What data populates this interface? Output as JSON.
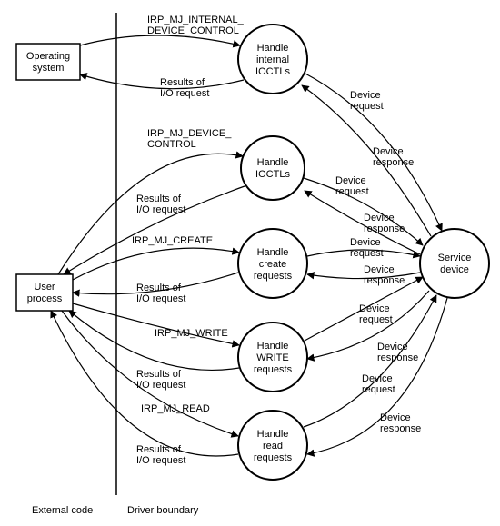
{
  "nodes": {
    "os": {
      "label1": "Operating",
      "label2": "system"
    },
    "user": {
      "label1": "User",
      "label2": "process"
    },
    "h_int": {
      "label1": "Handle",
      "label2": "internal",
      "label3": "IOCTLs"
    },
    "h_ioctl": {
      "label1": "Handle",
      "label2": "IOCTLs",
      "label3": ""
    },
    "h_create": {
      "label1": "Handle",
      "label2": "create",
      "label3": "requests"
    },
    "h_write": {
      "label1": "Handle",
      "label2": "WRITE",
      "label3": "requests"
    },
    "h_read": {
      "label1": "Handle",
      "label2": "read",
      "label3": "requests"
    },
    "svc": {
      "label1": "Service",
      "label2": "device"
    }
  },
  "edge_labels": {
    "irp_int_ioctl": "IRP_MJ_INTERNAL_",
    "irp_int_ioctl2": "DEVICE_CONTROL",
    "irp_dev_ctrl": "IRP_MJ_DEVICE_",
    "irp_dev_ctrl2": "CONTROL",
    "irp_create": "IRP_MJ_CREATE",
    "irp_write": "IRP_MJ_WRITE",
    "irp_read": "IRP_MJ_READ",
    "results1": "Results of",
    "results2": "I/O request",
    "dev_req": "Device",
    "dev_req2": "request",
    "dev_resp": "Device",
    "dev_resp2": "response"
  },
  "boundary": {
    "left": "External code",
    "right": "Driver boundary"
  }
}
